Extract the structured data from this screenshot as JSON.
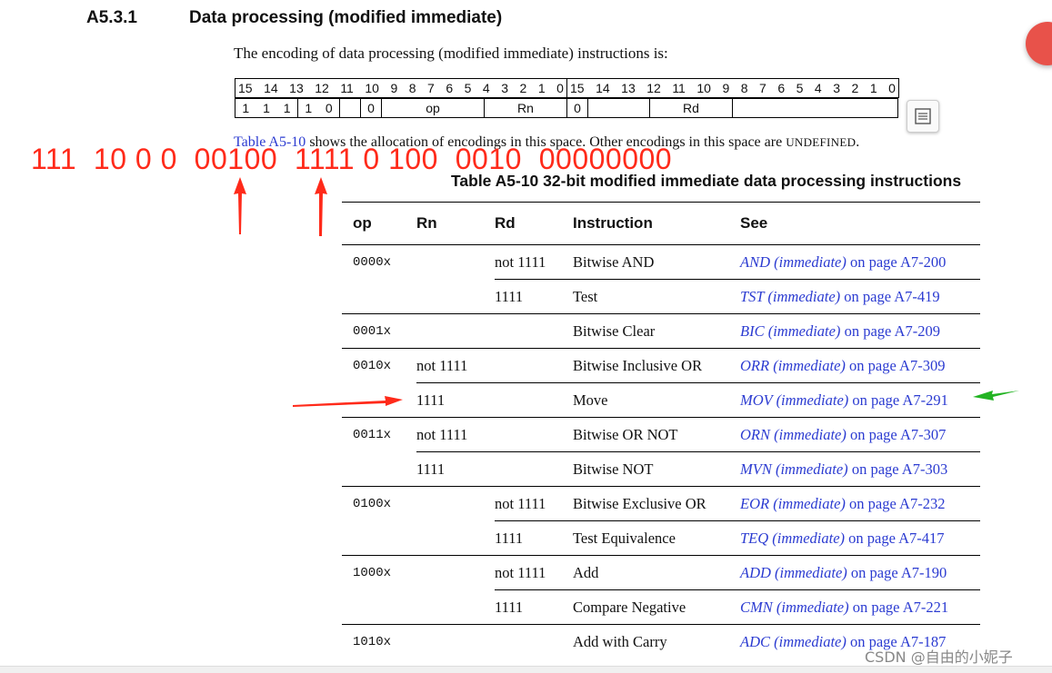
{
  "section": {
    "number": "A5.3.1",
    "title": "Data processing (modified immediate)"
  },
  "intro": "The encoding of data processing (modified immediate) instructions is:",
  "encoding": {
    "bit_numbers_left": [
      "15",
      "14",
      "13",
      "12",
      "11",
      "10",
      "9",
      "8",
      "7",
      "6",
      "5",
      "4",
      "3",
      "2",
      "1",
      "0"
    ],
    "bit_numbers_right": [
      "15",
      "14",
      "13",
      "12",
      "11",
      "10",
      "9",
      "8",
      "7",
      "6",
      "5",
      "4",
      "3",
      "2",
      "1",
      "0"
    ],
    "f111": [
      "1",
      "1",
      "1"
    ],
    "f10": [
      "1",
      "0"
    ],
    "zero0": "0",
    "op": "op",
    "rn": "Rn",
    "zero1": "0",
    "rd": "Rd"
  },
  "allocation": {
    "link": "Table A5-10",
    "text": " shows the allocation of encodings in this space. Other encodings in this space are ",
    "undefined": "UNDEFINED",
    "end": "."
  },
  "annotation_binary": "111  10 0 0  00100  1111 0 100  0010  00000000",
  "table": {
    "caption": "Table A5-10 32-bit modified immediate data processing instructions",
    "headers": {
      "op": "op",
      "rn": "Rn",
      "rd": "Rd",
      "instruction": "Instruction",
      "see": "See"
    },
    "rows": [
      {
        "op": "0000x",
        "rn": "",
        "rd": "not 1111",
        "instruction": "Bitwise AND",
        "see": "AND (immediate)",
        "page": " on page A7-200"
      },
      {
        "op": "",
        "rn": "",
        "rd": "1111",
        "instruction": "Test",
        "see": "TST (immediate)",
        "page": " on page A7-419"
      },
      {
        "op": "0001x",
        "rn": "",
        "rd": "",
        "instruction": "Bitwise Clear",
        "see": "BIC (immediate)",
        "page": " on page A7-209"
      },
      {
        "op": "0010x",
        "rn": "not 1111",
        "rd": "",
        "instruction": "Bitwise Inclusive OR",
        "see": "ORR (immediate)",
        "page": " on page A7-309"
      },
      {
        "op": "",
        "rn": "1111",
        "rd": "",
        "instruction": "Move",
        "see": "MOV (immediate)",
        "page": " on page A7-291"
      },
      {
        "op": "0011x",
        "rn": "not 1111",
        "rd": "",
        "instruction": "Bitwise OR NOT",
        "see": "ORN (immediate)",
        "page": " on page A7-307"
      },
      {
        "op": "",
        "rn": "1111",
        "rd": "",
        "instruction": "Bitwise NOT",
        "see": "MVN (immediate)",
        "page": " on page A7-303"
      },
      {
        "op": "0100x",
        "rn": "",
        "rd": "not 1111",
        "instruction": "Bitwise Exclusive OR",
        "see": "EOR (immediate)",
        "page": " on page A7-232"
      },
      {
        "op": "",
        "rn": "",
        "rd": "1111",
        "instruction": "Test Equivalence",
        "see": "TEQ (immediate)",
        "page": " on page A7-417"
      },
      {
        "op": "1000x",
        "rn": "",
        "rd": "not 1111",
        "instruction": "Add",
        "see": "ADD (immediate)",
        "page": " on page A7-190"
      },
      {
        "op": "",
        "rn": "",
        "rd": "1111",
        "instruction": "Compare Negative",
        "see": "CMN (immediate)",
        "page": " on page A7-221"
      },
      {
        "op": "1010x",
        "rn": "",
        "rd": "",
        "instruction": "Add with Carry",
        "see": "ADC (immediate)",
        "page": " on page A7-187"
      }
    ]
  },
  "watermark": "CSDN @自由的小妮子",
  "colors": {
    "link": "#2b3bd1",
    "annotation_red": "#ff2a1a",
    "annotation_green": "#22b322"
  },
  "icons": {
    "encoding_tool": "screenshot-tool-icon"
  }
}
